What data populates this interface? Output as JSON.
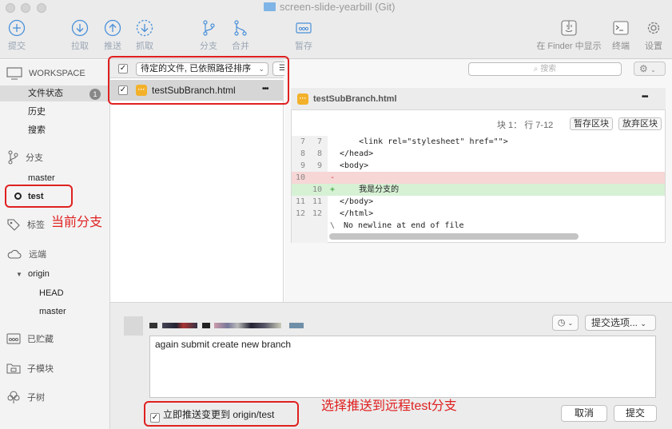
{
  "window": {
    "title": "screen-slide-yearbill (Git)"
  },
  "toolbar": {
    "commit": "提交",
    "pull": "拉取",
    "push": "推送",
    "fetch": "抓取",
    "branch": "分支",
    "merge": "合并",
    "stash": "暂存",
    "finder": "在 Finder 中显示",
    "terminal": "终端",
    "settings": "设置"
  },
  "sidebar": {
    "workspace": "WORKSPACE",
    "file_status": "文件状态",
    "file_status_count": "1",
    "history": "历史",
    "search": "搜索",
    "branches": "分支",
    "branch_master": "master",
    "branch_test": "test",
    "tags": "标签",
    "remotes": "远端",
    "origin": "origin",
    "remote_head": "HEAD",
    "remote_master": "master",
    "stashes": "已贮藏",
    "submodules": "子模块",
    "subtrees": "子树"
  },
  "filelist": {
    "sort": "待定的文件, 已依照路径排序",
    "file": "testSubBranch.html",
    "more": "•••"
  },
  "search": {
    "placeholder": "搜索"
  },
  "diff": {
    "filename": "testSubBranch.html",
    "more": "•••",
    "hunk_info": "块 1： 行 7-12",
    "stage_hunk": "暂存区块",
    "discard_hunk": "放弃区块",
    "lines": [
      {
        "old": "7",
        "new": "7",
        "sign": "",
        "text": "    <link rel=\"stylesheet\" href=\"\">"
      },
      {
        "old": "8",
        "new": "8",
        "sign": "",
        "text": "</head>"
      },
      {
        "old": "9",
        "new": "9",
        "sign": "",
        "text": "<body>"
      },
      {
        "old": "10",
        "new": "",
        "sign": "-",
        "text": ""
      },
      {
        "old": "",
        "new": "10",
        "sign": "+",
        "text": "    我是分支的"
      },
      {
        "old": "11",
        "new": "11",
        "sign": "",
        "text": "</body>"
      },
      {
        "old": "12",
        "new": "12",
        "sign": "",
        "text": "</html>"
      },
      {
        "old": "",
        "new": "",
        "sign": "\\",
        "text": "No newline at end of file"
      }
    ]
  },
  "commit": {
    "message": "again submit create new branch",
    "options": "提交选项...",
    "push_label": "立即推送变更到 origin/test",
    "cancel": "取消",
    "submit": "提交"
  },
  "annotations": {
    "current_branch": "当前分支",
    "push_note": "选择推送到远程test分支"
  },
  "colors": {
    "annotation_red": "#e02020",
    "file_icon": "#f3b12b",
    "deleted_line": "#f7d6d6",
    "added_line": "#d6f1d4"
  }
}
